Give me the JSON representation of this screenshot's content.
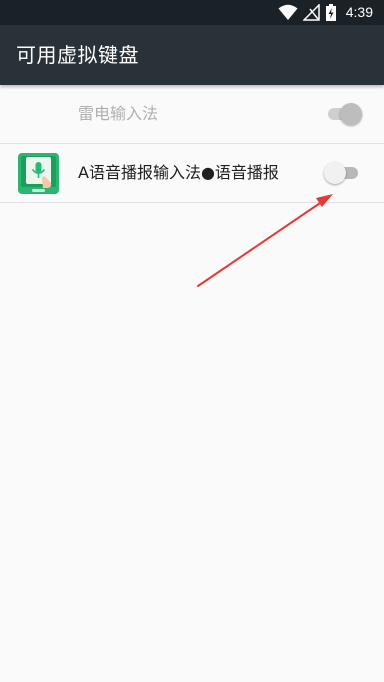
{
  "status_bar": {
    "time": "4:39",
    "icons": [
      "wifi-icon",
      "signal-off-icon",
      "battery-charging-icon"
    ]
  },
  "app_bar": {
    "title": "可用虚拟键盘"
  },
  "keyboards": [
    {
      "label": "雷电输入法",
      "enabled": true,
      "disabled": true,
      "icon": "none"
    },
    {
      "label": "A语音播报输入法●语音播报",
      "enabled": false,
      "disabled": false,
      "icon": "voice-keyboard-app-icon"
    }
  ],
  "annotation": {
    "type": "arrow",
    "color": "#e53935",
    "points_to": "A语音播报输入法●语音播报 toggle"
  }
}
